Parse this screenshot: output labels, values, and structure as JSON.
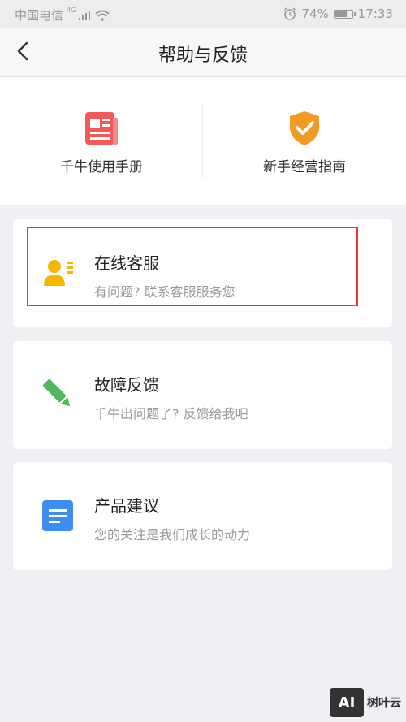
{
  "status_bar": {
    "carrier": "中国电信",
    "network": "4G",
    "battery": "74%",
    "battery_level": 0.74,
    "time": "17:33"
  },
  "nav": {
    "title": "帮助与反馈",
    "back_icon": "chevron-left-icon"
  },
  "quick_links": [
    {
      "label": "千牛使用手册",
      "icon": "manual-icon",
      "color": "#f05a5a"
    },
    {
      "label": "新手经营指南",
      "icon": "shield-check-icon",
      "color": "#f29a22"
    }
  ],
  "cards": [
    {
      "title": "在线客服",
      "subtitle": "有问题? 联系客服服务您",
      "icon": "customer-service-icon",
      "color": "#f5b700"
    },
    {
      "title": "故障反馈",
      "subtitle": "千牛出问题了? 反馈给我吧",
      "icon": "pencil-icon",
      "color": "#4cbb5b"
    },
    {
      "title": "产品建议",
      "subtitle": "您的关注是我们成长的动力",
      "icon": "document-icon",
      "color": "#3f8cf0"
    }
  ],
  "highlight_color": "#e03b3b",
  "watermark": {
    "logo_text": "AI",
    "text": "树叶云"
  }
}
